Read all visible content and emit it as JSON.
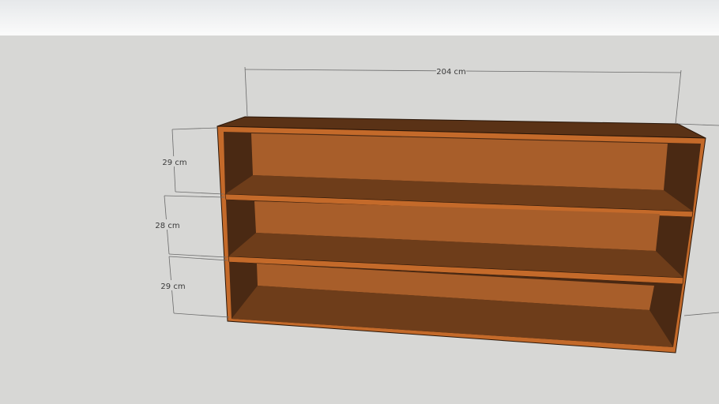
{
  "colors": {
    "sky_top": "#e6e8ea",
    "sky_bottom": "#fbfbfb",
    "ground": "#d7d7d5",
    "wood_edge": "#c46a2a",
    "wood_dark": "#4a2913",
    "wood_back": "#a85e2a",
    "wood_shelf": "#6e3d1a",
    "dimension_line": "#6a6a6a"
  },
  "dimensions": {
    "width": "204 cm",
    "top_compartment": "29 cm",
    "middle_compartment": "28 cm",
    "bottom_compartment": "29 cm"
  }
}
